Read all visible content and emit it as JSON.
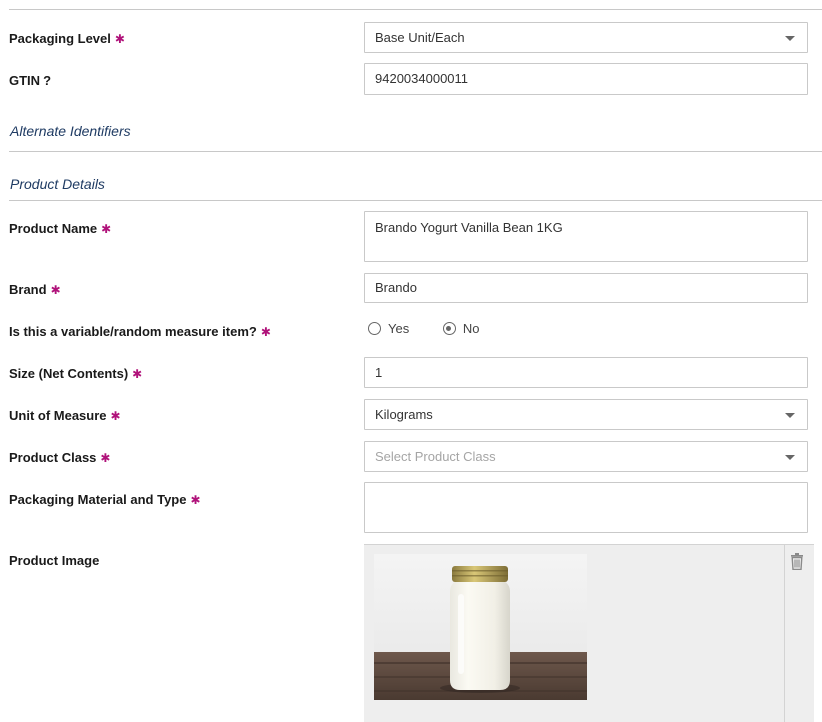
{
  "form": {
    "packaging_level": {
      "label": "Packaging Level",
      "value": "Base Unit/Each"
    },
    "gtin": {
      "label": "GTIN",
      "help": "?",
      "value": "9420034000011"
    },
    "product_name": {
      "label": "Product Name",
      "value": "Brando Yogurt Vanilla Bean 1KG"
    },
    "brand": {
      "label": "Brand",
      "value": "Brando"
    },
    "variable_measure": {
      "label": "Is this a variable/random measure item?",
      "options": [
        {
          "label": "Yes",
          "selected": false
        },
        {
          "label": "No",
          "selected": true
        }
      ]
    },
    "size": {
      "label": "Size (Net Contents)",
      "value": "1"
    },
    "unit_of_measure": {
      "label": "Unit of Measure",
      "value": "Kilograms"
    },
    "product_class": {
      "label": "Product Class",
      "placeholder": "Select Product Class"
    },
    "packaging_material": {
      "label": "Packaging Material and Type",
      "value": ""
    },
    "product_image": {
      "label": "Product Image"
    }
  },
  "sections": {
    "alternate_identifiers": "Alternate Identifiers",
    "product_details": "Product Details"
  },
  "required_marker": "✱",
  "icons": {
    "dropdown": "chevron-down-icon",
    "delete": "trash-icon"
  },
  "colors": {
    "required": "#b0127a",
    "section": "#1f3b63",
    "border": "#c9c9c9",
    "image_panel": "#eeeeee"
  }
}
